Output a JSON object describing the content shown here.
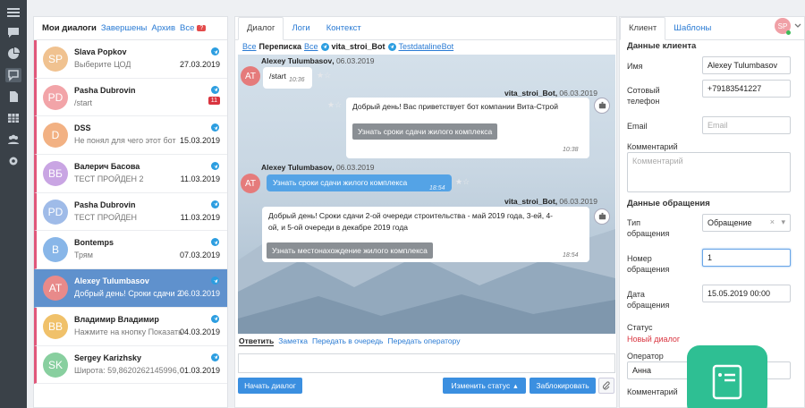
{
  "dialogs": {
    "tabs": [
      "Мои диалоги",
      "Завершены",
      "Архив",
      "Все"
    ],
    "all_badge": "?",
    "items": [
      {
        "initials": "SP",
        "color": "#f0c290",
        "name": "Slava Popkov",
        "msg": "Выберите ЦОД",
        "date": "27.03.2019",
        "count": ""
      },
      {
        "initials": "PD",
        "color": "#f2a4a8",
        "name": "Pasha Dubrovin",
        "msg": "/start",
        "date": "19.03.2019",
        "count": "11"
      },
      {
        "initials": "D",
        "color": "#f2b183",
        "name": "DSS",
        "msg": "Не понял для чего этот бот",
        "date": "15.03.2019",
        "count": ""
      },
      {
        "initials": "ВБ",
        "color": "#c9a5e3",
        "name": "Валерич Басова",
        "msg": "ТЕСТ ПРОЙДЕН 2",
        "date": "11.03.2019",
        "count": ""
      },
      {
        "initials": "PD",
        "color": "#9fbbe8",
        "name": "Pasha Dubrovin",
        "msg": "ТЕСТ ПРОЙДЕН",
        "date": "11.03.2019",
        "count": ""
      },
      {
        "initials": "B",
        "color": "#88b6e8",
        "name": "Bontemps",
        "msg": "Трям",
        "date": "07.03.2019",
        "count": ""
      },
      {
        "initials": "AT",
        "color": "#e88a8a",
        "name": "Alexey Tulumbasov",
        "msg": "Добрый день! Сроки сдачи 2",
        "date": "06.03.2019",
        "count": ""
      },
      {
        "initials": "ВВ",
        "color": "#f0c16a",
        "name": "Владимир Владимир",
        "msg": "Нажмите на кнопку Показать",
        "date": "04.03.2019",
        "count": ""
      },
      {
        "initials": "SK",
        "color": "#88cf9f",
        "name": "Sergey Karizhsky",
        "msg": "Широта: 59,8620262145996,",
        "date": "01.03.2019",
        "count": ""
      }
    ]
  },
  "center": {
    "tabs": [
      "Диалог",
      "Логи",
      "Контекст"
    ],
    "crumb": {
      "all1": "Все",
      "corr": "Переписка",
      "all2": "Все",
      "bot": "vita_stroi_Bot",
      "bot2": "TestdatalineBot"
    },
    "messages": {
      "u1_name": "Alexey Tulumbasov",
      "u1_date": "06.03.2019",
      "u1_text": "/start",
      "u1_time": "10:36",
      "b1_name": "vita_stroi_Bot",
      "b1_date": "06.03.2019",
      "b1_text": "Добрый день! Вас приветствует бот компании Вита-Строй",
      "b1_btn": "Узнать сроки сдачи жилого комплекса",
      "b1_time": "10:38",
      "u2_name": "Alexey Tulumbasov",
      "u2_date": "06.03.2019",
      "u2_text": "Узнать сроки сдачи жилого комплекса",
      "u2_time": "18:54",
      "b2_name": "vita_stroi_Bot",
      "b2_date": "06.03.2019",
      "b2_text1": "Добрый день! Сроки сдачи 2-ой очереди строительства - май 2019 года, 3-ей, 4-",
      "b2_text2": "ой, и 5-ой очереди в декабре 2019 года",
      "b2_btn": "Узнать местонахождение жилого комплекса",
      "b2_time": "18:54",
      "avatar": "AT"
    },
    "actions": [
      "Ответить",
      "Заметка",
      "Передать в очередь",
      "Передать оператору"
    ],
    "start_btn": "Начать диалог",
    "status_btn": "Изменить статус",
    "block_btn": "Заблокировать"
  },
  "right": {
    "tabs": [
      "Клиент",
      "Шаблоны"
    ],
    "client_title": "Данные клиента",
    "name_label": "Имя",
    "name_value": "Alexey Tulumbasov",
    "phone_label1": "Сотовый",
    "phone_label2": "телефон",
    "phone_value": "+79183541227",
    "email_label": "Email",
    "email_ph": "Email",
    "comment_label": "Комментарий",
    "comment_ph": "Комментарий",
    "req_title": "Данные обращения",
    "type_label1": "Тип",
    "type_label2": "обращения",
    "type_value": "Обращение",
    "num_label1": "Номер",
    "num_label2": "обращения",
    "num_value": "1",
    "date_label1": "Дата",
    "date_label2": "обращения",
    "date_value": "15.05.2019 00:00",
    "status_label": "Статус",
    "status_value": "Новый диалог",
    "op_label": "Оператор",
    "op_value": "Анна",
    "comment2_label": "Комментарий"
  },
  "user": {
    "initials": "SP"
  }
}
